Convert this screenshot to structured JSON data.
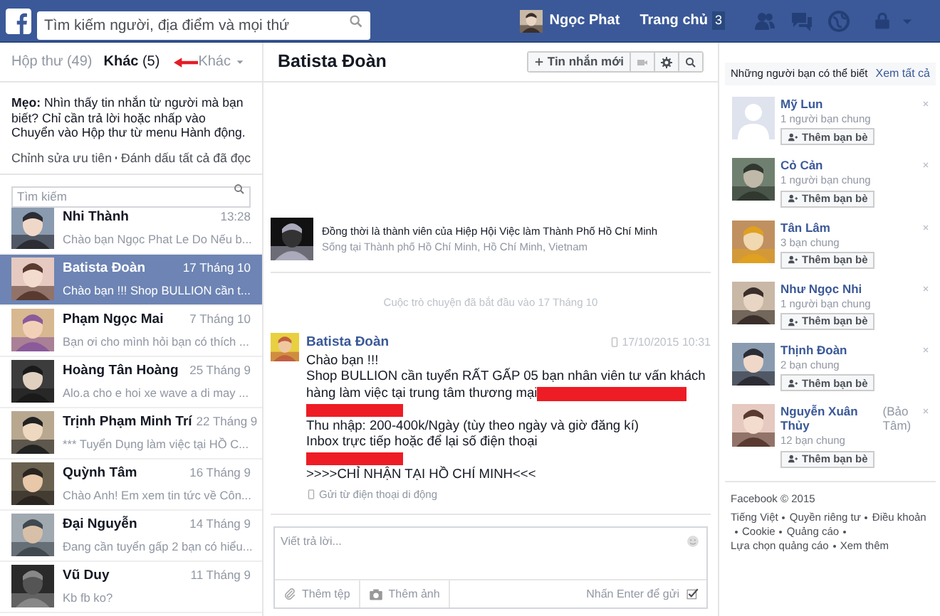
{
  "topbar": {
    "search": {
      "placeholder": "Tìm kiếm người, địa điểm và mọi thứ"
    },
    "user_name": "Ngọc Phat",
    "home": "Trang chủ",
    "home_badge": "3"
  },
  "folders": {
    "tabs": [
      {
        "label": "Hộp thư",
        "count": "(49)",
        "selected": false
      },
      {
        "label": "Khác",
        "count": "(5)",
        "selected": true
      }
    ],
    "more": "Khác"
  },
  "tip": {
    "text": "**Mẹo:** Nhìn thấy tin nhắn từ người mà bạn biết? Chỉ cần trả lời hoặc nhấp vào Chuyển vào Hộp thư từ menu Hành động.",
    "links": [
      "Chỉnh sửa ưu tiên",
      "Đánh dấu tất cả đã đọc"
    ]
  },
  "inbox_search": {
    "placeholder": "Tìm kiếm"
  },
  "threads": [
    {
      "name": "Nhi Thành",
      "time": "13:28",
      "snippet": "Chào bạn Ngọc Phat Le Do Nếu b...",
      "selected": false
    },
    {
      "name": "Batista Đoàn",
      "time": "17 Tháng 10",
      "snippet": "Chào bạn !!! Shop BULLION cần t...",
      "selected": true
    },
    {
      "name": "Phạm Ngọc Mai",
      "time": "7 Tháng 10",
      "snippet": "Bạn ơi cho mình hỏi bạn có thích ...",
      "selected": false
    },
    {
      "name": "Hoàng Tân Hoàng",
      "time": "25 Tháng 9",
      "snippet": "Alo.a cho e hoi xe wave a di may ...",
      "selected": false
    },
    {
      "name": "Trịnh Phạm Minh Trí",
      "time": "22 Tháng 9",
      "snippet": "*** Tuyển Dụng làm việc tại HỒ C...",
      "selected": false
    },
    {
      "name": "Quỳnh Tâm",
      "time": "16 Tháng 9",
      "snippet": "Chào Anh! Em xem tin tức về Côn...",
      "selected": false
    },
    {
      "name": "Đại Nguyễn",
      "time": "14 Tháng 9",
      "snippet": "Đang cần tuyển gấp 2 bạn có hiểu...",
      "selected": false
    },
    {
      "name": "Vũ Duy",
      "time": "11 Tháng 9",
      "snippet": "Kb fb ko?",
      "selected": false
    }
  ],
  "conversation": {
    "title": "Batista Đoàn",
    "new_message": "Tin nhắn mới",
    "profile": {
      "line_1": "Đồng thời là thành viên của Hiệp Hội Việc làm Thành Phố Hồ Chí Minh",
      "line_2": "Sống tại Thành phố Hồ Chí Minh, Hồ Chí Minh, Vietnam"
    },
    "started": "Cuộc trò chuyện đã bắt đầu vào 17 Tháng 10",
    "message": {
      "sender": "Batista Đoàn",
      "timestamp": "17/10/2015 10:31",
      "lines": [
        {
          "kind": "text",
          "text": "Chào bạn !!!",
          "redacted": false
        },
        {
          "kind": "text",
          "text": "Shop BULLION cần tuyển RẤT GẤP 05 bạn nhân viên tư vấn khách",
          "redacted": false
        },
        {
          "kind": "text",
          "text": "hàng làm việc tại trung tâm thương mại",
          "redacted": true
        },
        {
          "kind": "redaction"
        },
        {
          "kind": "text",
          "text": "Thu nhập: 200-400k/Ngày (tùy theo ngày và giờ đăng kí)",
          "redacted": false
        },
        {
          "kind": "text",
          "text": "Inbox trực tiếp hoặc để lại số điện thoại",
          "redacted": false
        },
        {
          "kind": "redaction"
        },
        {
          "kind": "text",
          "text": ">>>>CHỈ NHẬN TẠI HỒ CHÍ MINH<<<",
          "redacted": false
        }
      ],
      "source": "Gửi từ điện thoại di động"
    },
    "reply": {
      "placeholder": "Viết trả lời...",
      "add_file": "Thêm tệp",
      "add_photo": "Thêm ảnh",
      "enter_to_send": "Nhấn Enter để gửi",
      "enter_checked": true
    }
  },
  "suggestions": {
    "title": "Những người bạn có thể biết",
    "see_all": "Xem tất cả",
    "people": [
      {
        "name": "Mỹ Lun",
        "mutual": "1 người bạn chung",
        "kind": "silhouette",
        "button": "Thêm bạn bè"
      },
      {
        "name": "Cỏ Cản",
        "mutual": "1 người bạn chung",
        "button": "Thêm bạn bè"
      },
      {
        "name": "Tân Lâm",
        "mutual": "3 bạn chung",
        "button": "Thêm bạn bè"
      },
      {
        "name": "Như Ngọc Nhi",
        "mutual": "1 người bạn chung",
        "button": "Thêm bạn bè"
      },
      {
        "name": "Thịnh Đoàn",
        "mutual": "2 bạn chung",
        "button": "Thêm bạn bè"
      },
      {
        "name": "Nguyễn Xuân Thủy",
        "alias": "(Bảo Tâm)",
        "mutual": "12 bạn chung",
        "button": "Thêm bạn bè"
      }
    ]
  },
  "footer": {
    "copyright": "Facebook © 2015",
    "links": [
      "Tiếng Việt",
      "Quyền riêng tư",
      "Điều khoản",
      "Cookie",
      "Quảng cáo",
      "Lựa chọn quảng cáo",
      "Xem thêm"
    ]
  }
}
